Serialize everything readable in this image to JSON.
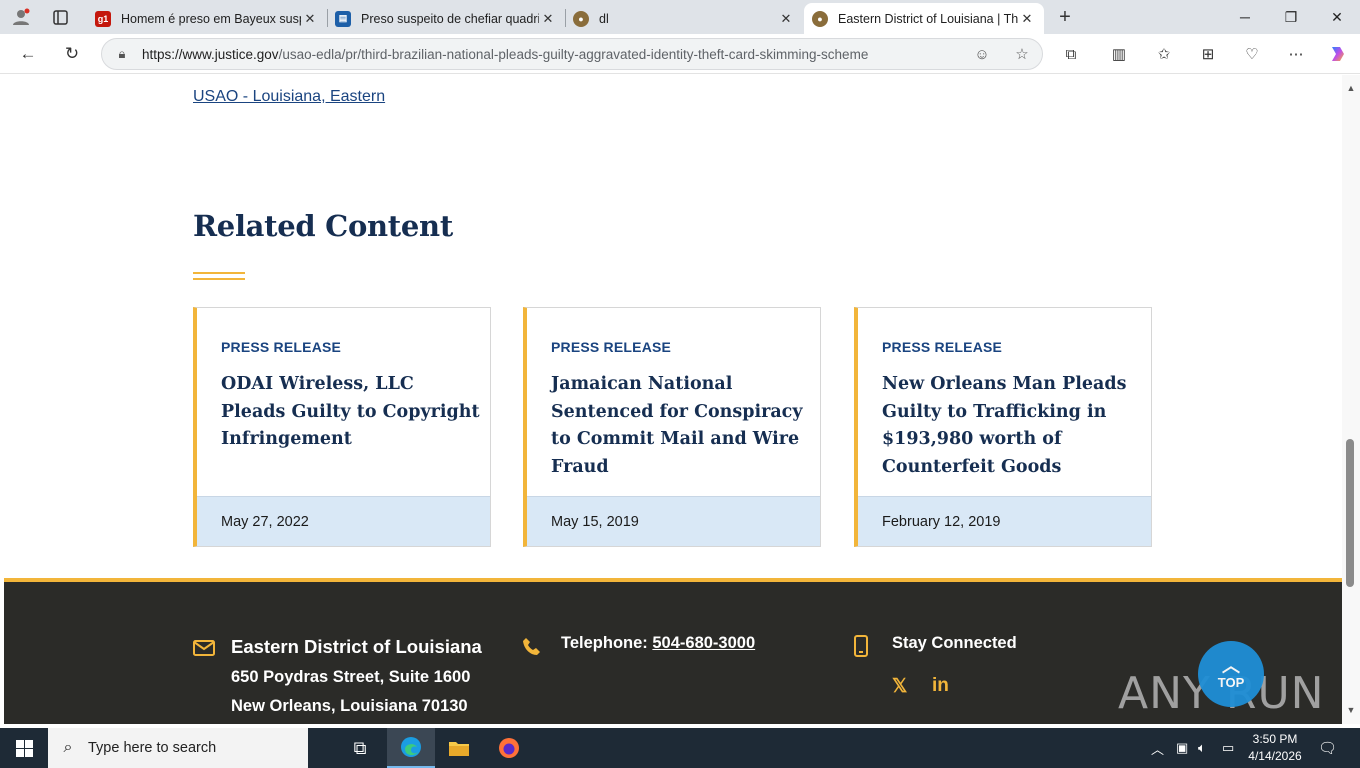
{
  "browser": {
    "tabs": [
      {
        "title": "Homem é preso em Bayeux suspe",
        "favicon": "g1"
      },
      {
        "title": "Preso suspeito de chefiar quadrilh",
        "favicon": "news"
      },
      {
        "title": "dl",
        "favicon": "doj-seal"
      },
      {
        "title": "Eastern District of Louisiana | Thir",
        "favicon": "doj-seal",
        "active": true
      }
    ],
    "new_tab_label": "+",
    "url_host": "https://www.justice.gov",
    "url_path": "/usao-edla/pr/third-brazilian-national-pleads-guilty-aggravated-identity-theft-card-skimming-scheme"
  },
  "page": {
    "top_link": "USAO - Louisiana, Eastern",
    "related_title": "Related Content",
    "cards": [
      {
        "kicker": "PRESS RELEASE",
        "headline": "ODAI Wireless, LLC Pleads Guilty to Copyright Infringement",
        "date": "May 27, 2022"
      },
      {
        "kicker": "PRESS RELEASE",
        "headline": "Jamaican National Sentenced for Conspiracy to Commit Mail and Wire Fraud",
        "date": "May 15, 2019"
      },
      {
        "kicker": "PRESS RELEASE",
        "headline": "New Orleans Man Pleads Guilty to Trafficking in $193,980 worth of Counterfeit Goods",
        "date": "February 12, 2019"
      }
    ]
  },
  "footer": {
    "office_name": "Eastern District of Louisiana",
    "address_line1": "650 Poydras Street, Suite 1600",
    "address_line2": "New Orleans, Louisiana 70130",
    "telephone_label": "Telephone: ",
    "telephone_number": "504-680-3000",
    "stay_connected": "Stay Connected",
    "top_button": "TOP"
  },
  "overlay": {
    "watermark": "ANY RUN"
  },
  "taskbar": {
    "search_placeholder": "Type here to search",
    "time": "3:50 PM",
    "date": "4/14/2026"
  },
  "colors": {
    "accent_gold": "#f2b53a",
    "navy": "#162e51",
    "link_blue": "#1a4480",
    "date_strip": "#d9e8f6",
    "footer_bg": "#2b2b28"
  }
}
